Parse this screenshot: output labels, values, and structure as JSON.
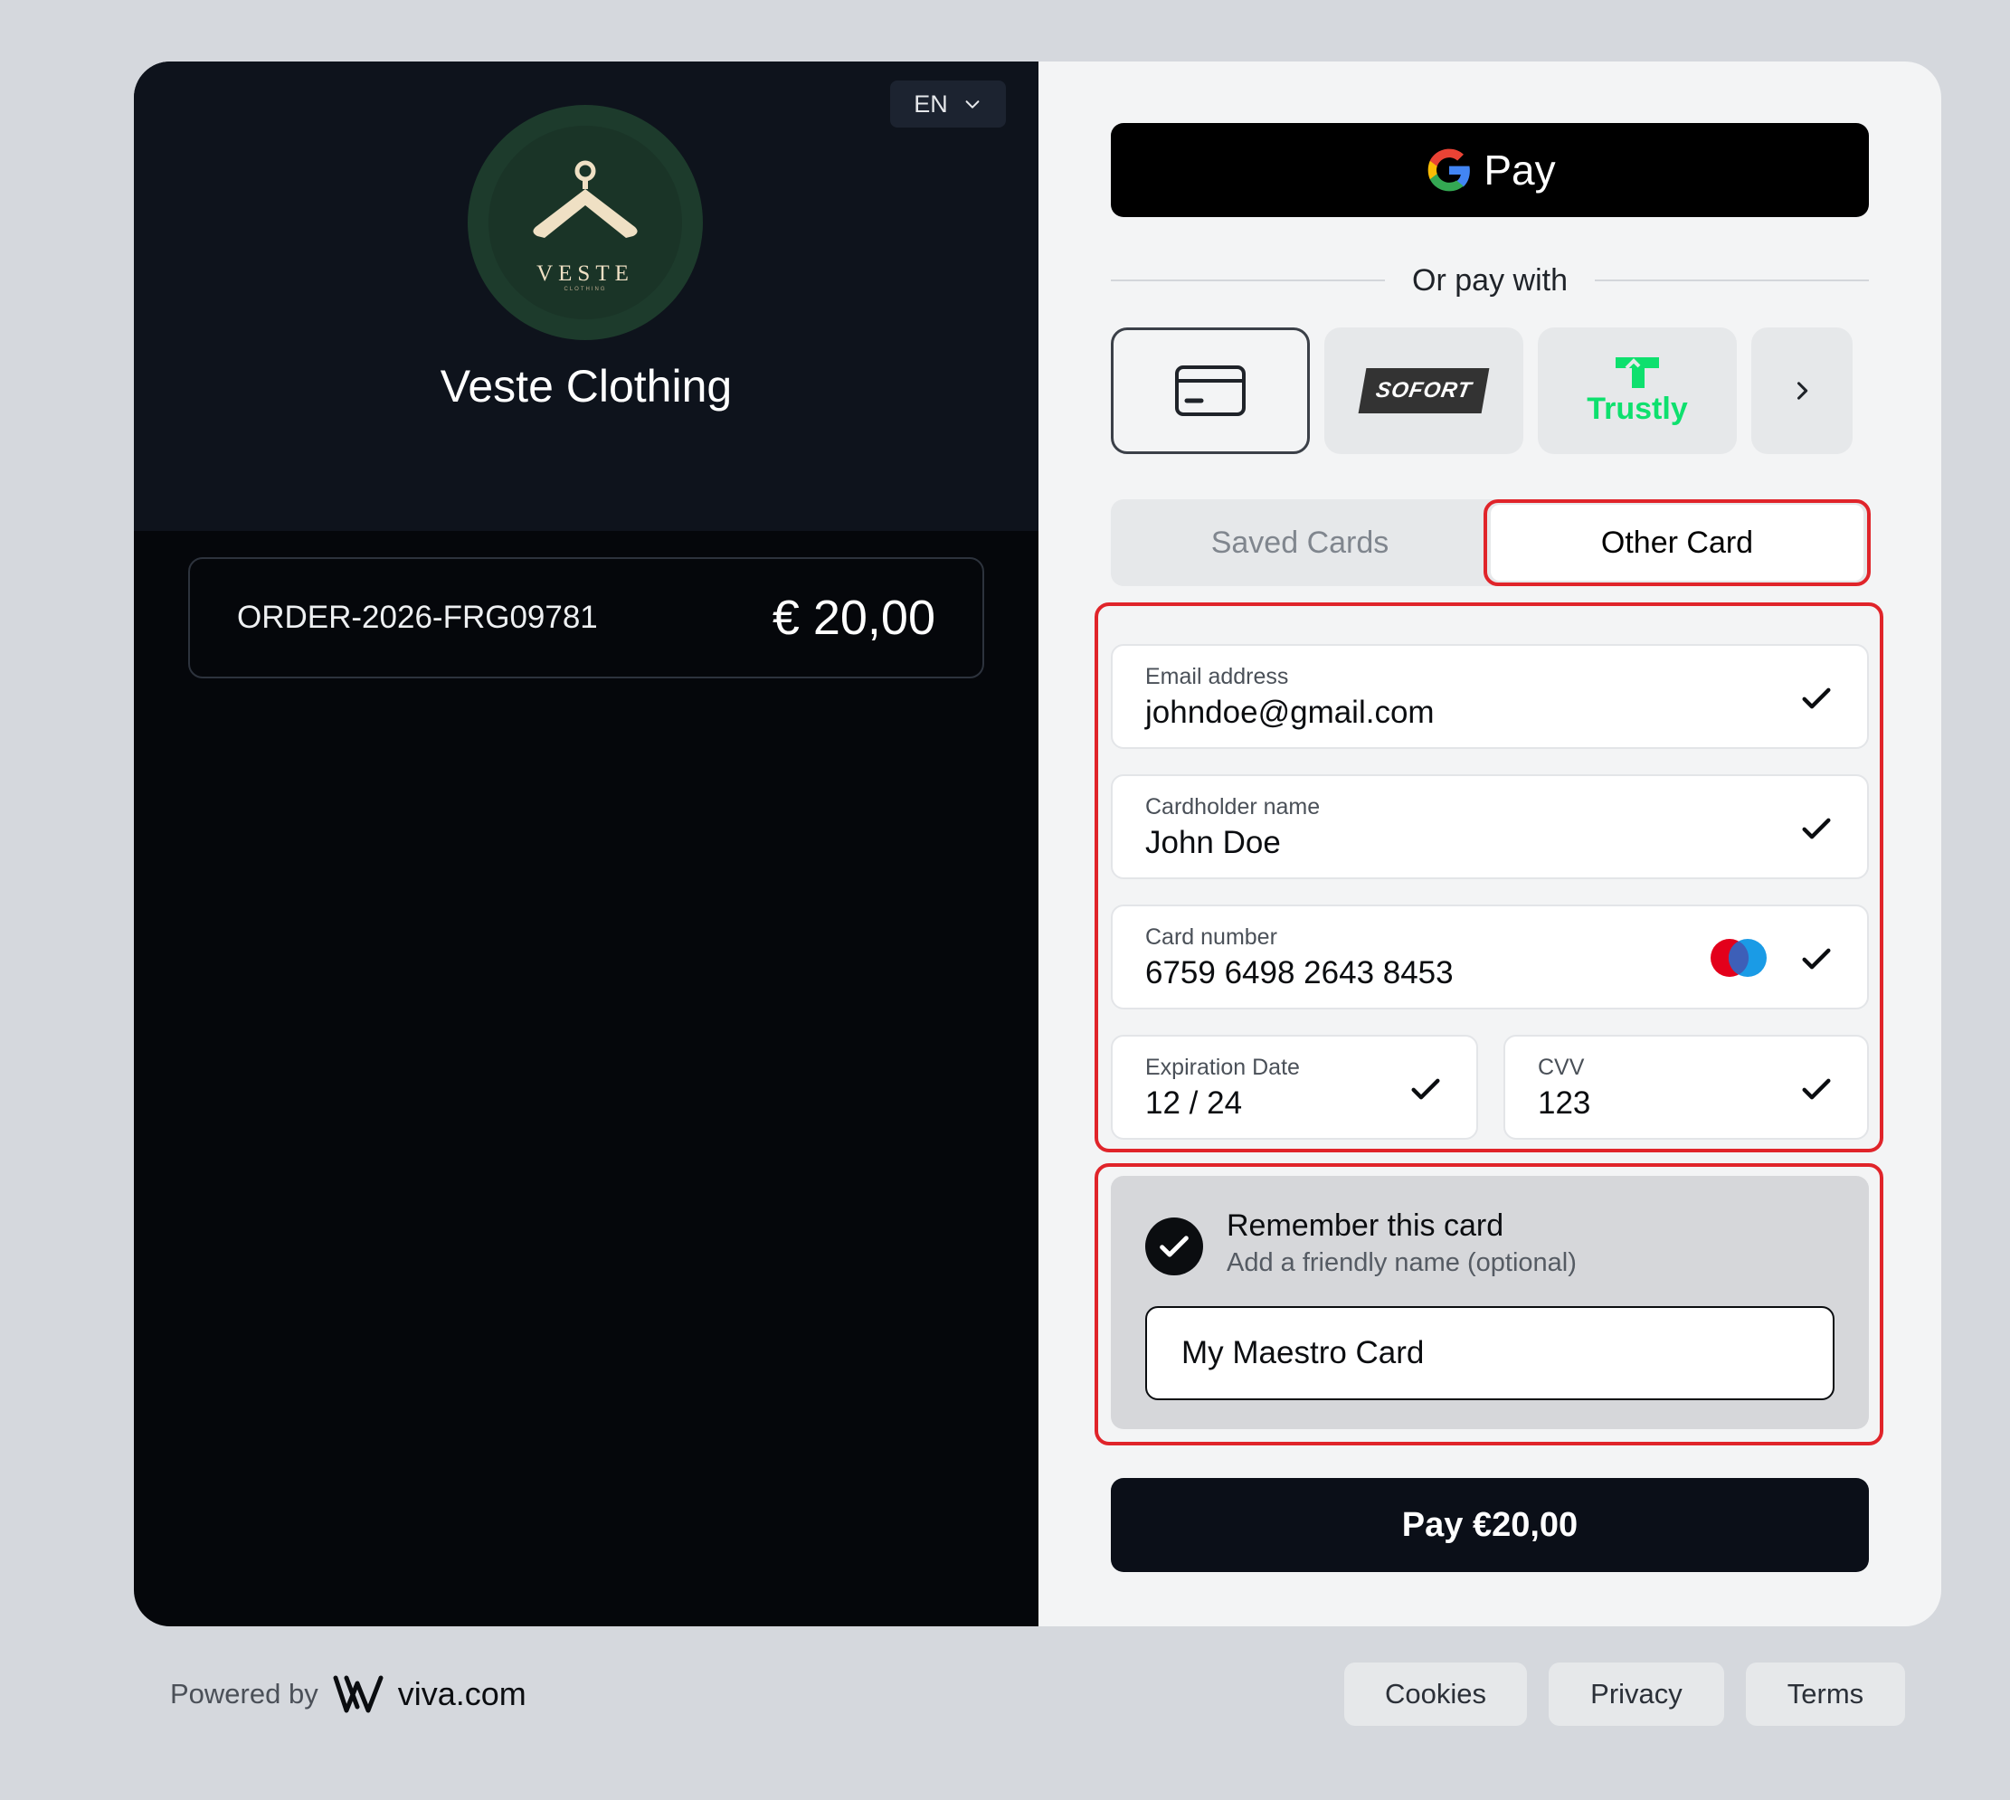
{
  "merchant": {
    "name": "Veste Clothing",
    "logo_text": "VESTE",
    "logo_subtext": "CLOTHING",
    "language": "EN"
  },
  "order": {
    "id": "ORDER-2026-FRG09781",
    "amount": "€ 20,00"
  },
  "gpay": {
    "label": "Pay"
  },
  "divider": {
    "label": "Or pay with"
  },
  "methods": {
    "sofort_label": "SOFORT",
    "trustly_label": "Trustly"
  },
  "tabs": {
    "saved": "Saved Cards",
    "other": "Other Card"
  },
  "form": {
    "email": {
      "label": "Email address",
      "value": "johndoe@gmail.com"
    },
    "cardholder": {
      "label": "Cardholder name",
      "value": "John Doe"
    },
    "card_number": {
      "label": "Card number",
      "value": "6759 6498 2643 8453"
    },
    "expiry": {
      "label": "Expiration Date",
      "value": "12 / 24"
    },
    "cvv": {
      "label": "CVV",
      "value": "123"
    }
  },
  "remember": {
    "title": "Remember this card",
    "subtitle": "Add a friendly name (optional)",
    "input_value": "My Maestro Card"
  },
  "pay_button": {
    "label": "Pay €20,00"
  },
  "footer": {
    "powered_by": "Powered by",
    "brand": "viva.com",
    "links": [
      "Cookies",
      "Privacy",
      "Terms"
    ]
  },
  "colors": {
    "highlight": "#e0242a",
    "trustly": "#0ee06e",
    "dark_panel": "#05070b",
    "accent_dark": "#0b0f18"
  }
}
